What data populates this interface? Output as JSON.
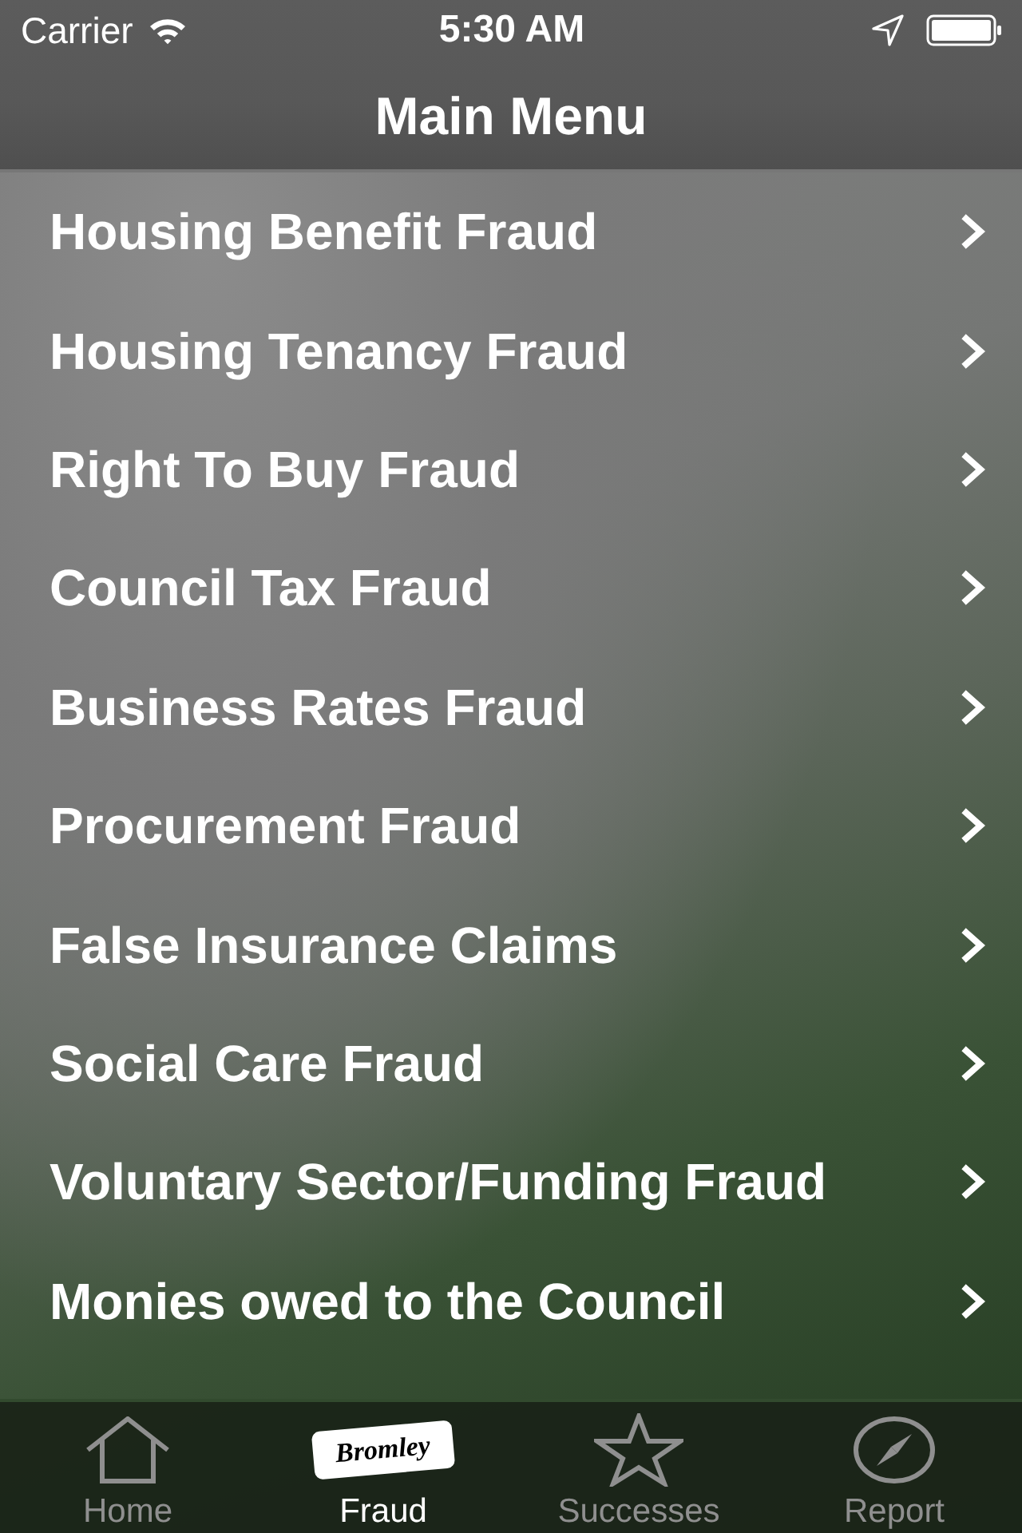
{
  "status_bar": {
    "carrier": "Carrier",
    "time": "5:30 AM"
  },
  "nav_bar": {
    "title": "Main Menu"
  },
  "menu": [
    {
      "label": "Housing Benefit Fraud"
    },
    {
      "label": "Housing Tenancy Fraud"
    },
    {
      "label": "Right To Buy Fraud"
    },
    {
      "label": "Council Tax Fraud"
    },
    {
      "label": "Business Rates Fraud"
    },
    {
      "label": "Procurement Fraud"
    },
    {
      "label": "False Insurance Claims"
    },
    {
      "label": "Social Care Fraud"
    },
    {
      "label": "Voluntary Sector/Funding Fraud"
    },
    {
      "label": "Monies owed to the Council"
    }
  ],
  "tab_bar": [
    {
      "label": "Home",
      "selected": false
    },
    {
      "label": "Fraud",
      "selected": true,
      "logo_text": "Bromley"
    },
    {
      "label": "Successes",
      "selected": false
    },
    {
      "label": "Report",
      "selected": false
    }
  ]
}
